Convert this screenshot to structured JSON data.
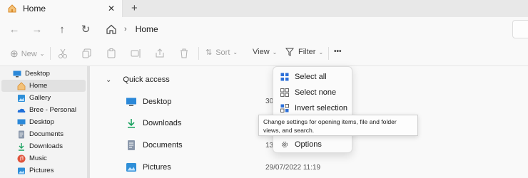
{
  "tab": {
    "title": "Home",
    "close": "✕",
    "new": "+"
  },
  "nav": {
    "back": "←",
    "forward": "→",
    "up": "↑",
    "refresh": "↻"
  },
  "address": {
    "crumb": "Home",
    "chevron": "›"
  },
  "commandbar": {
    "new_label": "New",
    "sort_label": "Sort",
    "view_label": "View",
    "filter_label": "Filter",
    "more_label": "•••",
    "dropdown": "⌄"
  },
  "sidebar": {
    "items": [
      {
        "label": "Desktop",
        "icon": "desktop-icon",
        "color": "#2b88d8"
      },
      {
        "label": "Home",
        "icon": "home-icon",
        "color": "#e08a3c"
      },
      {
        "label": "Gallery",
        "icon": "gallery-icon",
        "color": "#2f8fd8"
      },
      {
        "label": "Bree - Personal",
        "icon": "onedrive-icon",
        "color": "#1e6fd9"
      },
      {
        "label": "Desktop",
        "icon": "desktop-icon",
        "color": "#2b88d8"
      },
      {
        "label": "Documents",
        "icon": "documents-icon",
        "color": "#6b7a8f"
      },
      {
        "label": "Downloads",
        "icon": "downloads-icon",
        "color": "#1aa260"
      },
      {
        "label": "Music",
        "icon": "music-icon",
        "color": "#e0543c"
      },
      {
        "label": "Pictures",
        "icon": "pictures-icon",
        "color": "#2f8fd8"
      }
    ]
  },
  "main": {
    "section_title": "Quick access",
    "caret": "⌄",
    "rows": [
      {
        "label": "Desktop",
        "icon": "desktop-icon",
        "date": "30"
      },
      {
        "label": "Downloads",
        "icon": "downloads-icon",
        "date": ""
      },
      {
        "label": "Documents",
        "icon": "documents-icon",
        "date": "13"
      },
      {
        "label": "Pictures",
        "icon": "pictures-icon",
        "date": "29/07/2022 11:19"
      }
    ]
  },
  "menu": {
    "items": [
      {
        "label": "Select all",
        "icon": "select-all-icon"
      },
      {
        "label": "Select none",
        "icon": "select-none-icon"
      },
      {
        "label": "Invert selection",
        "icon": "invert-selection-icon"
      },
      {
        "label": "Options",
        "icon": "options-icon"
      }
    ]
  },
  "tooltip": {
    "text": "Change settings for opening items, file and folder views, and search."
  },
  "colors": {
    "accent": "#0067c0",
    "selected": "#e1e1e1",
    "menu_bg": "#fbfbfb"
  }
}
